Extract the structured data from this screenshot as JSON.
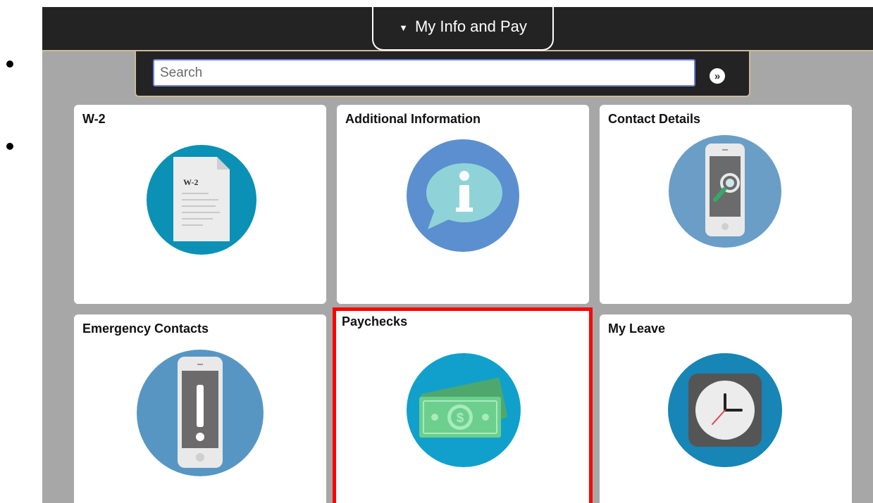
{
  "header": {
    "homepage_label": "My Info and Pay",
    "caret_icon": "triangle-down-icon"
  },
  "search": {
    "placeholder": "Search",
    "value": "",
    "go_icon": "double-chevron-right-icon"
  },
  "tiles": [
    {
      "title": "W-2",
      "icon": "w2-document-icon",
      "icon_text": "W-2",
      "color": "#0a91b5"
    },
    {
      "title": "Additional Information",
      "icon": "info-speech-bubble-icon",
      "color": "#5b8fcf"
    },
    {
      "title": "Contact Details",
      "icon": "phone-search-icon",
      "color": "#6a9ec6"
    },
    {
      "title": "Emergency Contacts",
      "icon": "phone-alert-icon",
      "color": "#5796c2"
    },
    {
      "title": "Paychecks",
      "icon": "money-bills-icon",
      "color": "#11a0cc",
      "selected": true
    },
    {
      "title": "My Leave",
      "icon": "clock-icon",
      "color": "#1785b5"
    }
  ],
  "colors": {
    "highlight": "#ff0000",
    "header_bg": "#232323",
    "accent_border": "#cdb99a",
    "page_bg": "#a7a7a7"
  }
}
